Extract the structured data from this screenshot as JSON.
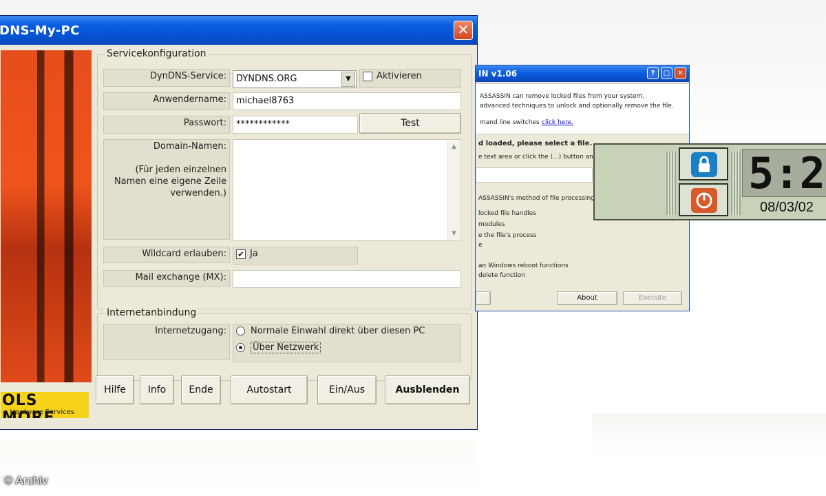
{
  "main_window": {
    "title": "DNS-My-PC",
    "close_glyph": "✕",
    "logo": {
      "big": "OLS MORE",
      "small": "e Hardware Services"
    },
    "service_group": {
      "legend": "Servicekonfiguration",
      "dyndns_label": "DynDNS-Service:",
      "dyndns_value": "DYNDNS.ORG",
      "activate_label": "Aktivieren",
      "user_label": "Anwendername:",
      "user_value": "michael8763",
      "password_label": "Passwort:",
      "password_value": "************",
      "test_button": "Test",
      "domain_label": "Domain-Namen:",
      "domain_hint": "(Für jeden einzelnen Namen eine eigene Zeile verwenden.)",
      "domain_value": "",
      "wildcard_label": "Wildcard erlauben:",
      "wildcard_option": "Ja",
      "mx_label": "Mail exchange (MX):",
      "mx_value": ""
    },
    "internet_group": {
      "legend": "Internetanbindung",
      "access_label": "Internetzugang:",
      "option_direct": "Normale Einwahl direkt über diesen PC",
      "option_network": "Über Netzwerk",
      "selected": "Über Netzwerk"
    },
    "buttons": {
      "help": "Hilfe",
      "info": "Info",
      "end": "Ende",
      "autostart": "Autostart",
      "onoff": "Ein/Aus",
      "hide": "Ausblenden"
    }
  },
  "second_window": {
    "title": "IN v1.06",
    "lines": [
      "ASSASSIN can remove locked files from your system.",
      "advanced techniques to unlock and optionally remove the file.",
      "mand line switches"
    ],
    "link": "click here.",
    "loaded": "d loaded, please select a file.",
    "textarea_hint": "e text area or click the (...) button and",
    "method": "ASSASSIN's method of file processing",
    "options": [
      "locked file handles",
      "modules",
      "e the file's process",
      "e",
      "an Windows reboot functions",
      "delete function"
    ],
    "about_button": "About",
    "execute_button": "Execute"
  },
  "clock_widget": {
    "time": "5:2",
    "date": "08/03/02",
    "lock_icon": "lock-icon",
    "power_icon": "power-icon"
  },
  "watermark": "© Archiv"
}
